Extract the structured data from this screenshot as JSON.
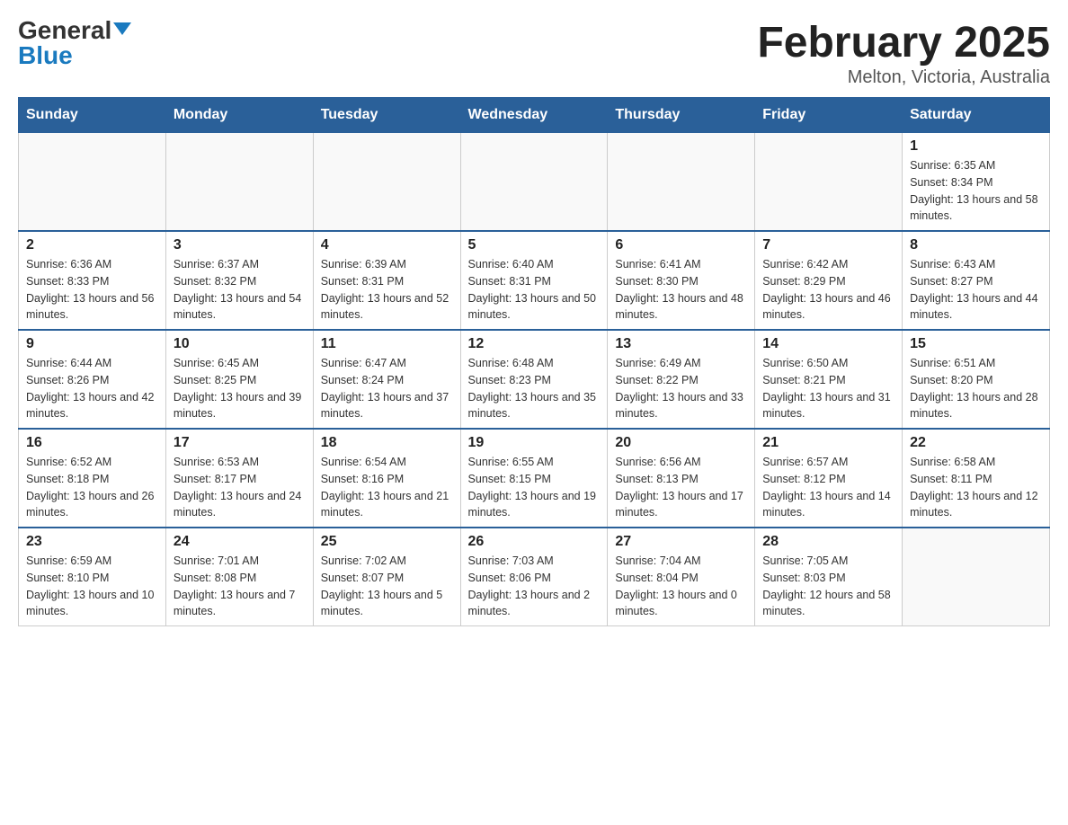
{
  "header": {
    "logo": {
      "general": "General",
      "triangle": "▲",
      "blue": "Blue"
    },
    "title": "February 2025",
    "location": "Melton, Victoria, Australia"
  },
  "weekdays": [
    "Sunday",
    "Monday",
    "Tuesday",
    "Wednesday",
    "Thursday",
    "Friday",
    "Saturday"
  ],
  "weeks": [
    [
      {
        "day": "",
        "info": ""
      },
      {
        "day": "",
        "info": ""
      },
      {
        "day": "",
        "info": ""
      },
      {
        "day": "",
        "info": ""
      },
      {
        "day": "",
        "info": ""
      },
      {
        "day": "",
        "info": ""
      },
      {
        "day": "1",
        "info": "Sunrise: 6:35 AM\nSunset: 8:34 PM\nDaylight: 13 hours and 58 minutes."
      }
    ],
    [
      {
        "day": "2",
        "info": "Sunrise: 6:36 AM\nSunset: 8:33 PM\nDaylight: 13 hours and 56 minutes."
      },
      {
        "day": "3",
        "info": "Sunrise: 6:37 AM\nSunset: 8:32 PM\nDaylight: 13 hours and 54 minutes."
      },
      {
        "day": "4",
        "info": "Sunrise: 6:39 AM\nSunset: 8:31 PM\nDaylight: 13 hours and 52 minutes."
      },
      {
        "day": "5",
        "info": "Sunrise: 6:40 AM\nSunset: 8:31 PM\nDaylight: 13 hours and 50 minutes."
      },
      {
        "day": "6",
        "info": "Sunrise: 6:41 AM\nSunset: 8:30 PM\nDaylight: 13 hours and 48 minutes."
      },
      {
        "day": "7",
        "info": "Sunrise: 6:42 AM\nSunset: 8:29 PM\nDaylight: 13 hours and 46 minutes."
      },
      {
        "day": "8",
        "info": "Sunrise: 6:43 AM\nSunset: 8:27 PM\nDaylight: 13 hours and 44 minutes."
      }
    ],
    [
      {
        "day": "9",
        "info": "Sunrise: 6:44 AM\nSunset: 8:26 PM\nDaylight: 13 hours and 42 minutes."
      },
      {
        "day": "10",
        "info": "Sunrise: 6:45 AM\nSunset: 8:25 PM\nDaylight: 13 hours and 39 minutes."
      },
      {
        "day": "11",
        "info": "Sunrise: 6:47 AM\nSunset: 8:24 PM\nDaylight: 13 hours and 37 minutes."
      },
      {
        "day": "12",
        "info": "Sunrise: 6:48 AM\nSunset: 8:23 PM\nDaylight: 13 hours and 35 minutes."
      },
      {
        "day": "13",
        "info": "Sunrise: 6:49 AM\nSunset: 8:22 PM\nDaylight: 13 hours and 33 minutes."
      },
      {
        "day": "14",
        "info": "Sunrise: 6:50 AM\nSunset: 8:21 PM\nDaylight: 13 hours and 31 minutes."
      },
      {
        "day": "15",
        "info": "Sunrise: 6:51 AM\nSunset: 8:20 PM\nDaylight: 13 hours and 28 minutes."
      }
    ],
    [
      {
        "day": "16",
        "info": "Sunrise: 6:52 AM\nSunset: 8:18 PM\nDaylight: 13 hours and 26 minutes."
      },
      {
        "day": "17",
        "info": "Sunrise: 6:53 AM\nSunset: 8:17 PM\nDaylight: 13 hours and 24 minutes."
      },
      {
        "day": "18",
        "info": "Sunrise: 6:54 AM\nSunset: 8:16 PM\nDaylight: 13 hours and 21 minutes."
      },
      {
        "day": "19",
        "info": "Sunrise: 6:55 AM\nSunset: 8:15 PM\nDaylight: 13 hours and 19 minutes."
      },
      {
        "day": "20",
        "info": "Sunrise: 6:56 AM\nSunset: 8:13 PM\nDaylight: 13 hours and 17 minutes."
      },
      {
        "day": "21",
        "info": "Sunrise: 6:57 AM\nSunset: 8:12 PM\nDaylight: 13 hours and 14 minutes."
      },
      {
        "day": "22",
        "info": "Sunrise: 6:58 AM\nSunset: 8:11 PM\nDaylight: 13 hours and 12 minutes."
      }
    ],
    [
      {
        "day": "23",
        "info": "Sunrise: 6:59 AM\nSunset: 8:10 PM\nDaylight: 13 hours and 10 minutes."
      },
      {
        "day": "24",
        "info": "Sunrise: 7:01 AM\nSunset: 8:08 PM\nDaylight: 13 hours and 7 minutes."
      },
      {
        "day": "25",
        "info": "Sunrise: 7:02 AM\nSunset: 8:07 PM\nDaylight: 13 hours and 5 minutes."
      },
      {
        "day": "26",
        "info": "Sunrise: 7:03 AM\nSunset: 8:06 PM\nDaylight: 13 hours and 2 minutes."
      },
      {
        "day": "27",
        "info": "Sunrise: 7:04 AM\nSunset: 8:04 PM\nDaylight: 13 hours and 0 minutes."
      },
      {
        "day": "28",
        "info": "Sunrise: 7:05 AM\nSunset: 8:03 PM\nDaylight: 12 hours and 58 minutes."
      },
      {
        "day": "",
        "info": ""
      }
    ]
  ]
}
